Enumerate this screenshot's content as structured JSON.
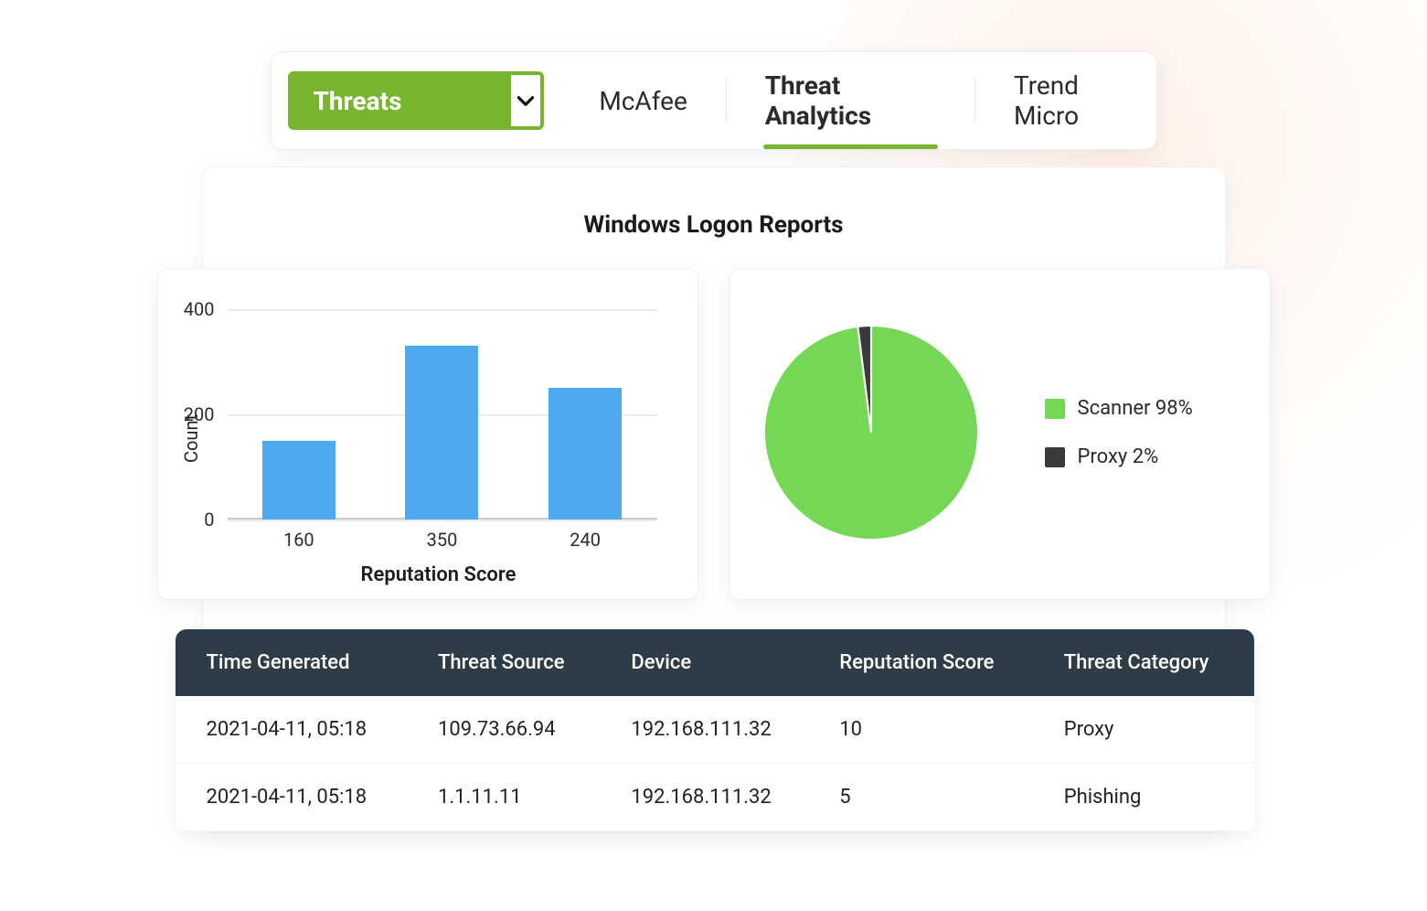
{
  "tabs": {
    "dropdown_label": "Threats",
    "items": [
      {
        "label": "McAfee",
        "active": false
      },
      {
        "label": "Threat Analytics",
        "active": true
      },
      {
        "label": "Trend Micro",
        "active": false
      }
    ]
  },
  "page_title": "Windows Logon Reports",
  "colors": {
    "accent": "#77b52e",
    "bar": "#4fa9ee",
    "pie_primary": "#74d755",
    "pie_secondary": "#3a3a3a",
    "table_header_bg": "#2e3c47"
  },
  "chart_data": [
    {
      "type": "bar",
      "ylabel": "Count",
      "xlabel": "Reputation Score",
      "ylim": [
        0,
        400
      ],
      "y_ticks": [
        0,
        200,
        400
      ],
      "categories": [
        "160",
        "350",
        "240"
      ],
      "values": [
        150,
        330,
        250
      ]
    },
    {
      "type": "pie",
      "series": [
        {
          "name": "Scanner",
          "value": 98,
          "label": "Scanner 98%",
          "color": "#74d755"
        },
        {
          "name": "Proxy",
          "value": 2,
          "label": "Proxy 2%",
          "color": "#3a3a3a"
        }
      ]
    }
  ],
  "table": {
    "columns": [
      "Time Generated",
      "Threat Source",
      "Device",
      "Reputation Score",
      "Threat Category"
    ],
    "rows": [
      {
        "time": "2021-04-11, 05:18",
        "source": "109.73.66.94",
        "device": "192.168.111.32",
        "score": "10",
        "category": "Proxy"
      },
      {
        "time": "2021-04-11, 05:18",
        "source": "1.1.11.11",
        "device": "192.168.111.32",
        "score": "5",
        "category": "Phishing"
      }
    ]
  }
}
